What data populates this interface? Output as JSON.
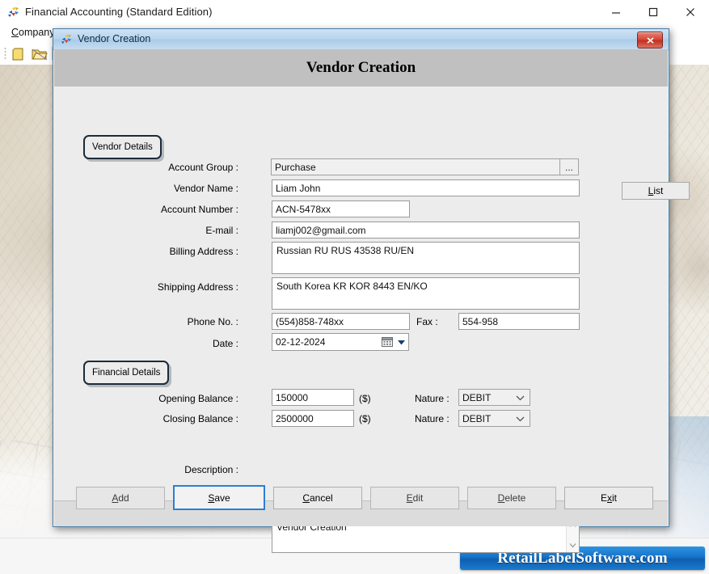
{
  "app": {
    "title": "Financial Accounting (Standard Edition)",
    "icon": "app-puzzle-icon",
    "window_controls": {
      "minimize": "minimize-icon",
      "maximize": "maximize-icon",
      "close": "close-icon"
    },
    "menu": {
      "company": "Company"
    },
    "toolbar": {
      "new_icon": "new-file-icon",
      "open_icon": "open-folder-icon"
    },
    "watermark": "RetailLabelSoftware.com"
  },
  "dialog": {
    "titlebar": {
      "icon": "app-puzzle-icon",
      "title": "Vendor Creation",
      "close": "close-icon"
    },
    "heading": "Vendor Creation",
    "list_button": {
      "label": "List",
      "accel": "L"
    },
    "sections": {
      "vendor_details": "Vendor Details",
      "financial_details": "Financial Details"
    },
    "fields": {
      "account_group": {
        "label": "Account Group :",
        "value": "Purchase",
        "browse": "..."
      },
      "vendor_name": {
        "label": "Vendor Name :",
        "value": "Liam John"
      },
      "account_number": {
        "label": "Account Number :",
        "value": "ACN-5478xx"
      },
      "email": {
        "label": "E-mail :",
        "value": "liamj002@gmail.com"
      },
      "billing_address": {
        "label": "Billing Address :",
        "value": "Russian RU RUS 43538 RU/EN"
      },
      "shipping_address": {
        "label": "Shipping Address :",
        "value": "South Korea KR KOR 8443 EN/KO"
      },
      "phone": {
        "label": "Phone No. :",
        "value": "(554)858-748xx"
      },
      "fax": {
        "label": "Fax :",
        "value": "554-958"
      },
      "date": {
        "label": "Date :",
        "value": "02-12-2024",
        "icon": "calendar-icon"
      },
      "opening_balance": {
        "label": "Opening Balance :",
        "value": "150000",
        "unit": "($)"
      },
      "opening_nature": {
        "label": "Nature :",
        "value": "DEBIT"
      },
      "closing_balance": {
        "label": "Closing Balance :",
        "value": "2500000",
        "unit": "($)"
      },
      "closing_nature": {
        "label": "Nature :",
        "value": "DEBIT"
      },
      "description": {
        "label": "Description :",
        "value": "Vendor Creation"
      }
    },
    "buttons": [
      {
        "label": "Add",
        "accel": "A",
        "rest": "dd",
        "pre": "",
        "state": "disabled"
      },
      {
        "label": "Save",
        "accel": "S",
        "rest": "ave",
        "pre": "",
        "state": "default"
      },
      {
        "label": "Cancel",
        "accel": "C",
        "rest": "ancel",
        "pre": "",
        "state": "enabled"
      },
      {
        "label": "Edit",
        "accel": "E",
        "rest": "dit",
        "pre": "",
        "state": "disabled"
      },
      {
        "label": "Delete",
        "accel": "D",
        "rest": "elete",
        "pre": "",
        "state": "disabled"
      },
      {
        "label": "Exit",
        "accel": "x",
        "rest": "it",
        "pre": "E",
        "state": "enabled"
      }
    ]
  },
  "colors": {
    "dialog_border": "#4a7fa6",
    "header_band": "#c0c0c0",
    "body": "#ececec",
    "titlebar": "#b8d4ec",
    "close_red": "#c1301f",
    "primary_button": "#2a7fd4",
    "watermark_blue": "#1572c9"
  }
}
